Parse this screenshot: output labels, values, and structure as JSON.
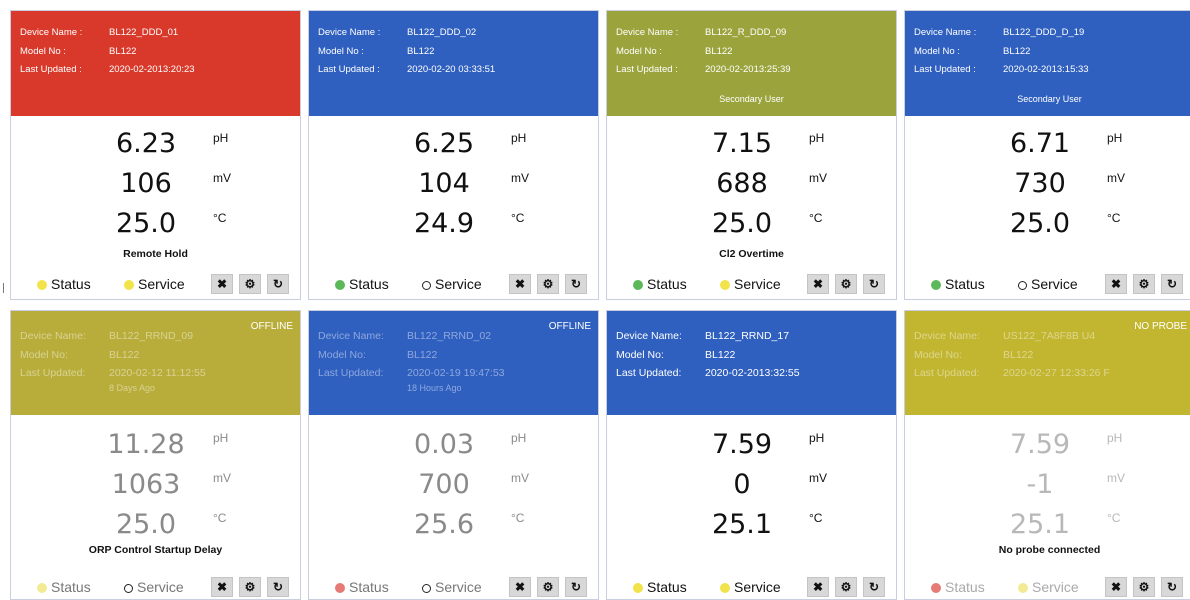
{
  "cards": [
    {
      "device_name_label": "Device Name :",
      "model_no_label": "Model No :",
      "last_updated_label": "Last Updated :",
      "device_name": "BL122_DDD_01",
      "model_no": "BL122",
      "last_updated": "2020-02-2013:20:23",
      "note": "",
      "offline": "",
      "header_color": "#d9392b",
      "ph": "6.23",
      "mv": "106",
      "temp": "25.0",
      "ph_unit": "pH",
      "mv_unit": "mV",
      "temp_unit": "°C",
      "message": "Remote Hold",
      "status_label": "Status",
      "service_label": "Service",
      "status_dot": "#f2e34a",
      "service_dot": "#f2e34a"
    },
    {
      "device_name_label": "Device Name :",
      "model_no_label": "Model No :",
      "last_updated_label": "Last Updated :",
      "device_name": "BL122_DDD_02",
      "model_no": "BL122",
      "last_updated": "2020-02-20 03:33:51",
      "note": "",
      "offline": "",
      "header_color": "#2f5fbf",
      "ph": "6.25",
      "mv": "104",
      "temp": "24.9",
      "ph_unit": "pH",
      "mv_unit": "mV",
      "temp_unit": "°C",
      "message": "",
      "status_label": "Status",
      "service_label": "Service",
      "status_dot": "#5db85a",
      "service_dot": "ring"
    },
    {
      "device_name_label": "Device Name :",
      "model_no_label": "Model No :",
      "last_updated_label": "Last Updated :",
      "device_name": "BL122_R_DDD_09",
      "model_no": "BL122",
      "last_updated": "2020-02-2013:25:39",
      "note": "Secondary User",
      "offline": "",
      "header_color": "#9ba33c",
      "ph": "7.15",
      "mv": "688",
      "temp": "25.0",
      "ph_unit": "pH",
      "mv_unit": "mV",
      "temp_unit": "°C",
      "message": "Cl2 Overtime",
      "status_label": "Status",
      "service_label": "Service",
      "status_dot": "#5db85a",
      "service_dot": "#f2e34a"
    },
    {
      "device_name_label": "Device Name :",
      "model_no_label": "Model No :",
      "last_updated_label": "Last Updated :",
      "device_name": "BL122_DDD_D_19",
      "model_no": "BL122",
      "last_updated": "2020-02-2013:15:33",
      "note": "Secondary User",
      "offline": "",
      "header_color": "#2f5fbf",
      "ph": "6.71",
      "mv": "730",
      "temp": "25.0",
      "ph_unit": "pH",
      "mv_unit": "mV",
      "temp_unit": "°C",
      "message": "",
      "status_label": "Status",
      "service_label": "Service",
      "status_dot": "#5db85a",
      "service_dot": "ring"
    },
    {
      "device_name_label": "Device Name:",
      "model_no_label": "Model No:",
      "last_updated_label": "Last Updated:",
      "device_name": "BL122_RRND_09",
      "model_no": "BL122",
      "last_updated": "2020-02-12 11:12:55",
      "note": "8 Days Ago",
      "offline": "OFFLINE",
      "header_color": "#b8ad3a",
      "ph": "11.28",
      "mv": "1063",
      "temp": "25.0",
      "ph_unit": "pH",
      "mv_unit": "mV",
      "temp_unit": "°C",
      "message": "ORP Control Startup Delay",
      "status_label": "Status",
      "service_label": "Service",
      "status_dot": "#f3ea94",
      "service_dot": "ring"
    },
    {
      "device_name_label": "Device Name:",
      "model_no_label": "Model No:",
      "last_updated_label": "Last Updated:",
      "device_name": "BL122_RRND_02",
      "model_no": "BL122",
      "last_updated": "2020-02-19 19:47:53",
      "note": "18 Hours Ago",
      "offline": "OFFLINE",
      "header_color": "#2f5fbf",
      "ph": "0.03",
      "mv": "700",
      "temp": "25.6",
      "ph_unit": "pH",
      "mv_unit": "mV",
      "temp_unit": "°C",
      "message": "",
      "status_label": "Status",
      "service_label": "Service",
      "status_dot": "#e57b74",
      "service_dot": "ring"
    },
    {
      "device_name_label": "Device Name:",
      "model_no_label": "Model No:",
      "last_updated_label": "Last Updated:",
      "device_name": "BL122_RRND_17",
      "model_no": "BL122",
      "last_updated": "2020-02-2013:32:55",
      "note": "",
      "offline": "",
      "header_color": "#2f5fbf",
      "ph": "7.59",
      "mv": "0",
      "temp": "25.1",
      "ph_unit": "pH",
      "mv_unit": "mV",
      "temp_unit": "°C",
      "message": "",
      "status_label": "Status",
      "service_label": "Service",
      "status_dot": "#f2e34a",
      "service_dot": "#f2e34a"
    },
    {
      "device_name_label": "Device Name:",
      "model_no_label": "Model No:",
      "last_updated_label": "Last Updated:",
      "device_name": "US122_7A8F8B U4",
      "model_no": "BL122",
      "last_updated": "2020-02-27 12:33:26 F",
      "note": "",
      "offline": "NO PROBE",
      "header_color": "#c2b530",
      "ph": "7.59",
      "mv": "-1",
      "temp": "25.1",
      "ph_unit": "pH",
      "mv_unit": "mV",
      "temp_unit": "°C",
      "message": "No probe connected",
      "status_label": "Status",
      "service_label": "Service",
      "status_dot": "#e57b74",
      "service_dot": "#f3ea94"
    }
  ],
  "action_icons": {
    "expand": "✖",
    "settings": "⚙",
    "reset": "↻"
  }
}
